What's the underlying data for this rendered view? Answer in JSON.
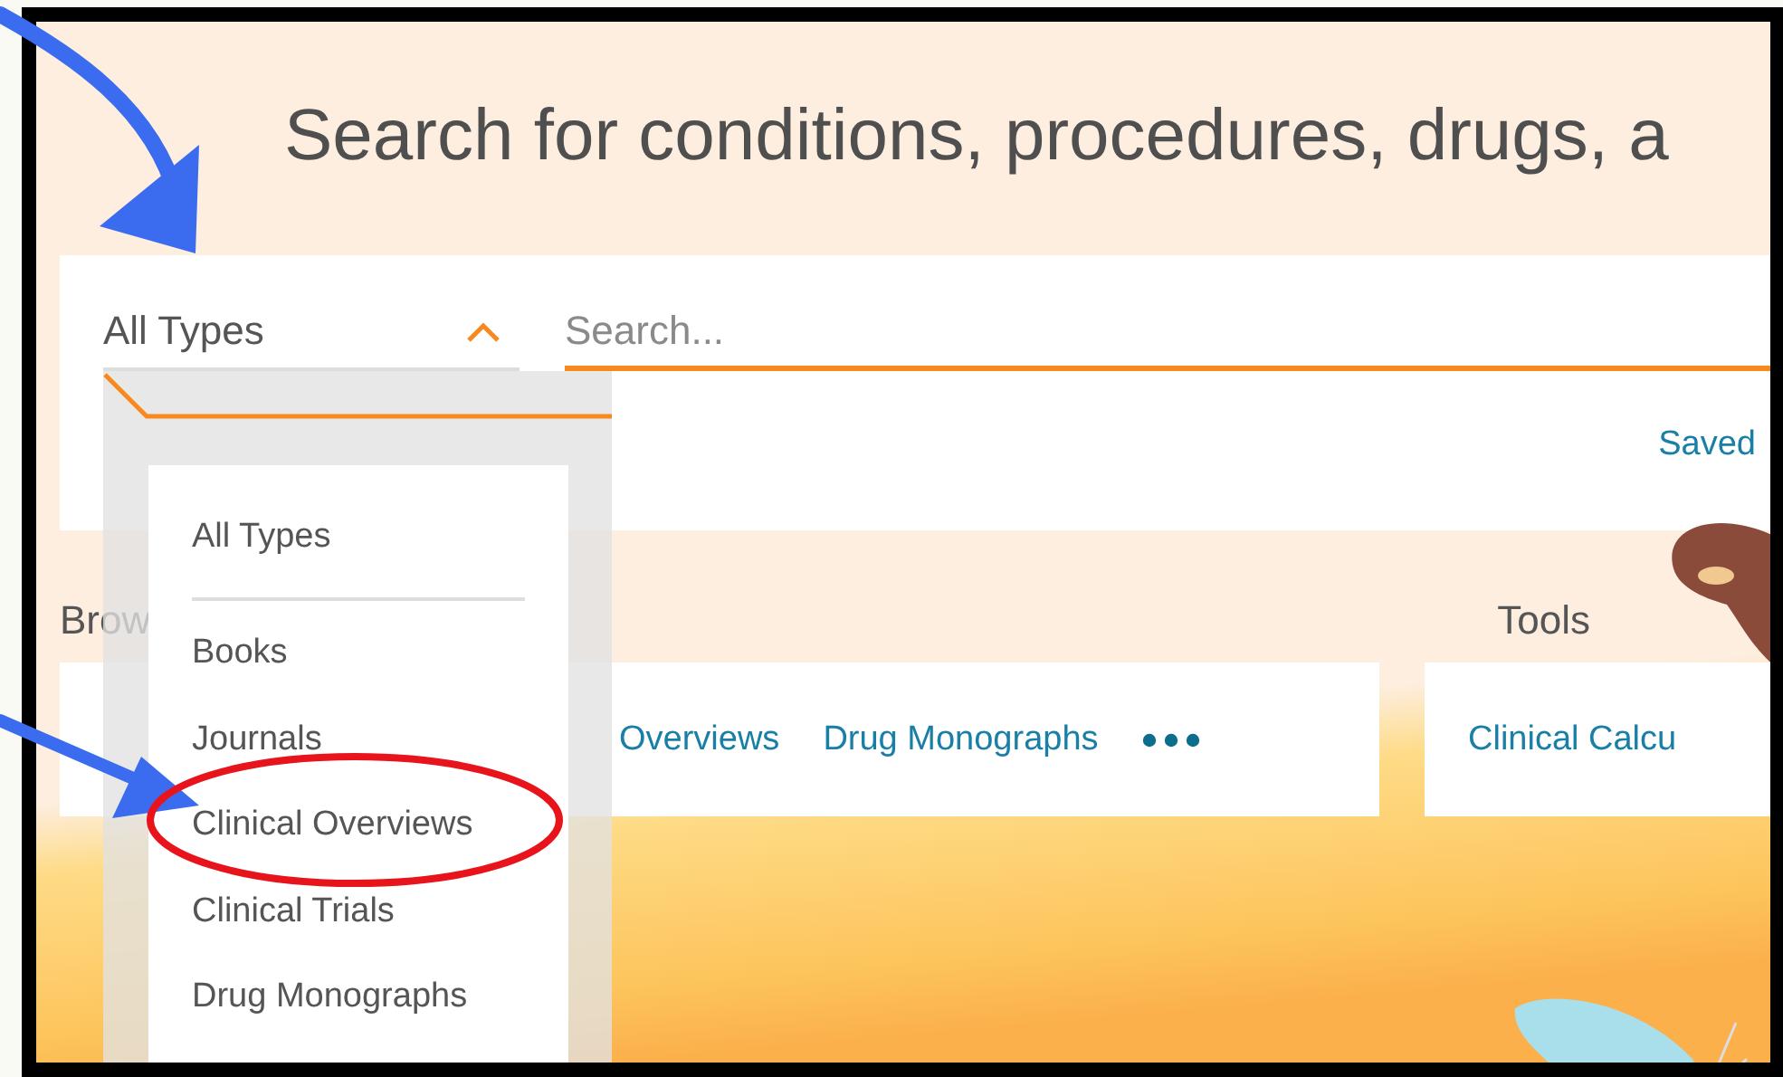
{
  "heading": "Search for conditions, procedures, drugs, a",
  "type_select": {
    "value": "All Types",
    "expanded": true
  },
  "search": {
    "placeholder": "Search..."
  },
  "saved_link": "Saved",
  "type_options": [
    {
      "label": "All Types"
    },
    {
      "label": "Books"
    },
    {
      "label": "Journals"
    },
    {
      "label": "Clinical Overviews"
    },
    {
      "label": "Clinical Trials"
    },
    {
      "label": "Drug Monographs"
    }
  ],
  "browse": {
    "label": "Brow",
    "links": [
      "Overviews",
      "Drug Monographs"
    ]
  },
  "tools": {
    "label": "Tools",
    "links": [
      "Clinical Calcu"
    ]
  }
}
